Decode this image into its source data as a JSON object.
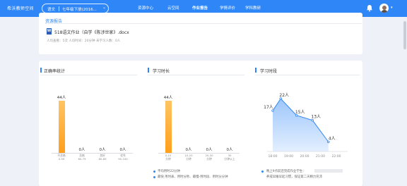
{
  "topbar": {
    "logo": "希沃教师空间",
    "subject": "语文",
    "grade": "七年级下册(2016...",
    "nav": [
      "资源中心",
      "云空间",
      "作业报告",
      "学情评价",
      "学科教研"
    ],
    "active_nav": "作业报告"
  },
  "resource": {
    "title": "资源报告",
    "doc_icon": "W",
    "doc_name": "518语文作业（自学《陈涉世家》.docx",
    "meta": "人均查看：5次   人均时间：20分钟   未学习人数：0人"
  },
  "accuracy": {
    "title": "正确率统计",
    "chart_data": {
      "type": "bar",
      "categories": [
        "不及格\n0-59",
        "及格\n60-79",
        "良好\n80-89",
        "优秀\n90-100"
      ],
      "values": [
        44,
        0,
        0,
        0
      ],
      "value_labels": [
        "44人",
        "0人",
        "0人",
        "0人"
      ]
    }
  },
  "duration": {
    "title": "学习时长",
    "chart_data": {
      "type": "bar",
      "categories": [
        "0-10\n分钟",
        "10-20\n分钟",
        "20-30\n分钟",
        "30\n分钟以上"
      ],
      "values": [
        44,
        0,
        0,
        0
      ],
      "value_labels": [
        "44人",
        "0人",
        "0人",
        "0人"
      ]
    },
    "legend": [
      "平均用时22分钟",
      "最快 用时表、用时分秒、最慢-用时段、用时分分钟"
    ]
  },
  "timeslot": {
    "title": "学习时段",
    "chart_data": {
      "type": "area",
      "x": [
        "18:00",
        "19:00",
        "20:00",
        "21:00",
        "22:00"
      ],
      "points": [
        {
          "x": 18.0,
          "y": 17
        },
        {
          "x": 18.5,
          "y": 22
        },
        {
          "x": 19.5,
          "y": 15
        },
        {
          "x": 20.5,
          "y": 13
        },
        {
          "x": 21.5,
          "y": 4
        }
      ],
      "point_labels": [
        "17人",
        "22人",
        "15人",
        "13人",
        "4人"
      ],
      "ylim": [
        0,
        22
      ],
      "color": "#2f86f6"
    },
    "legend": [
      "晚上9点前还完成作业学生：",
      "养成早睡早起习惯，保证第二天精力充沛"
    ]
  }
}
